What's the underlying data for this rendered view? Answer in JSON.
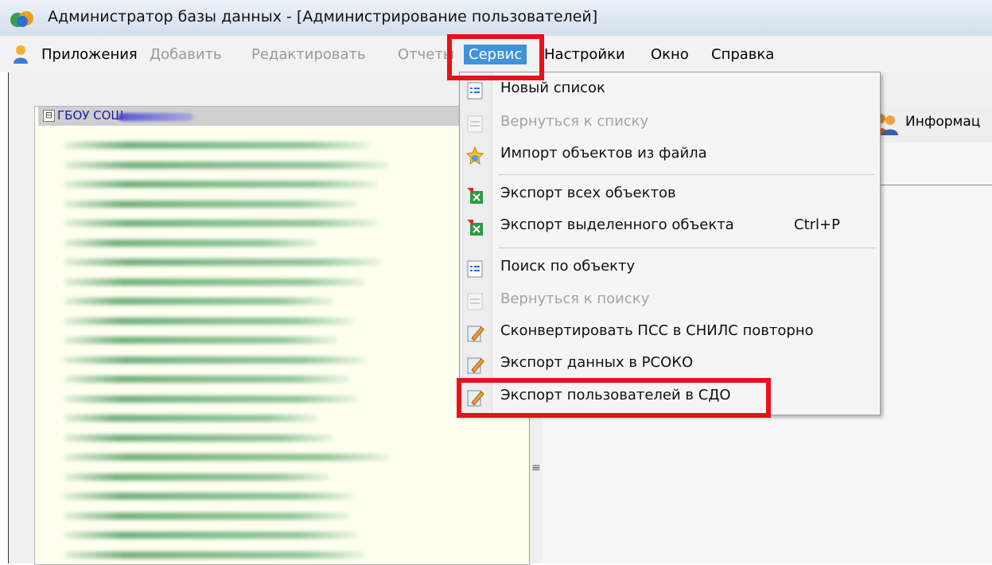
{
  "window": {
    "title": "Администратор базы данных - [Администрирование пользователей]"
  },
  "menubar": {
    "items": [
      {
        "label": "Приложения",
        "enabled": true
      },
      {
        "label": "Добавить",
        "enabled": false
      },
      {
        "label": "Редактировать",
        "enabled": false
      },
      {
        "label": "Отчеты",
        "enabled": false
      },
      {
        "label": "Сервис",
        "enabled": true,
        "active": true
      },
      {
        "label": "Настройки",
        "enabled": true
      },
      {
        "label": "Окно",
        "enabled": true
      },
      {
        "label": "Справка",
        "enabled": true
      }
    ]
  },
  "tree": {
    "root_label": "ГБОУ СОШ",
    "toggle_symbol": "⊟",
    "blurred_row_count": 22
  },
  "right_panel": {
    "info_button_label": "Информац"
  },
  "splitter": {
    "grip_symbol": "≡"
  },
  "service_menu": {
    "items": [
      {
        "label": "Новый список",
        "icon": "list-doc-icon",
        "enabled": true
      },
      {
        "label": "Вернуться к списку",
        "icon": "list-doc-icon",
        "enabled": false
      },
      {
        "label": "Импорт объектов из файла",
        "icon": "import-star-icon",
        "enabled": true
      },
      {
        "label": "Экспорт всех объектов",
        "icon": "export-excel-icon",
        "enabled": true
      },
      {
        "label": "Экспорт выделенного объекта",
        "icon": "export-excel-icon",
        "enabled": true,
        "shortcut": "Ctrl+P"
      },
      {
        "label": "Поиск по объекту",
        "icon": "list-doc-icon",
        "enabled": true
      },
      {
        "label": "Вернуться к поиску",
        "icon": "list-doc-icon",
        "enabled": false
      },
      {
        "label": "Сконвертировать ПСС в СНИЛС повторно",
        "icon": "edit-doc-icon",
        "enabled": true
      },
      {
        "label": "Экспорт данных в РСОКО",
        "icon": "edit-doc-icon",
        "enabled": true
      },
      {
        "label": "Экспорт пользователей в СДО",
        "icon": "edit-doc-icon",
        "enabled": true,
        "highlighted": true
      }
    ]
  },
  "colors": {
    "highlight_border": "#e8101c",
    "menu_active_bg": "#3f93dc",
    "tree_background": "#fffff0",
    "tree_root_text": "#1a1aa0"
  }
}
